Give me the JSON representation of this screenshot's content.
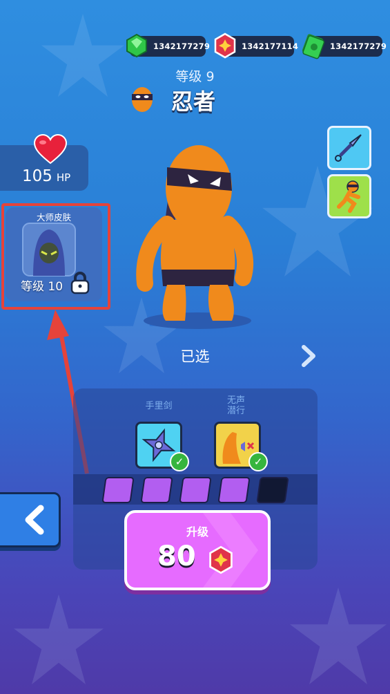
{
  "currencies": [
    {
      "name": "gem",
      "value": "1342177279",
      "color": "#31c94b"
    },
    {
      "name": "shuriken-coin",
      "value": "1342177114",
      "color": "#e0344a"
    },
    {
      "name": "cash",
      "value": "1342177279",
      "color": "#31c94b"
    }
  ],
  "character": {
    "level_text": "等级 9",
    "name": "忍者",
    "status": "已选"
  },
  "hp": {
    "value": "105",
    "unit": "HP"
  },
  "skin": {
    "label": "大师皮肤",
    "level_text": "等级 10"
  },
  "skills": [
    {
      "label": "手里剑",
      "icon": "shuriken-icon",
      "unlocked": true
    },
    {
      "label": "无声\n潜行",
      "icon": "silent-foot-icon",
      "unlocked": true
    }
  ],
  "upgrade": {
    "label": "升级",
    "cost": "80",
    "filled_segments": 4,
    "total_segments": 5
  },
  "colors": {
    "accent_red": "#e5433a",
    "seg_filled": "#b25ef0",
    "seg_empty": "#111833",
    "upgrade": "#e66bff"
  }
}
